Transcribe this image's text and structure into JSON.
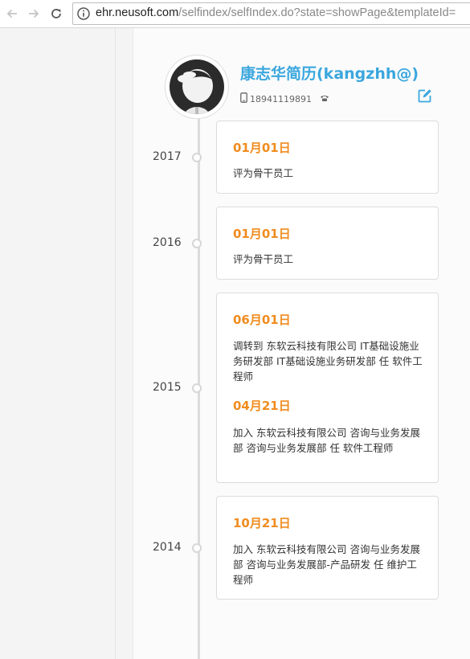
{
  "browser": {
    "url_host": "ehr.neusoft.com",
    "url_path": "/selfindex/selfIndex.do?state=showPage&templateId="
  },
  "profile": {
    "name": "康志华简历(kangzhh@)",
    "phone": "18941119891"
  },
  "timeline": [
    {
      "year": "2017",
      "events": [
        {
          "date": "01月01日",
          "text": "评为骨干员工"
        }
      ]
    },
    {
      "year": "2016",
      "events": [
        {
          "date": "01月01日",
          "text": "评为骨干员工"
        }
      ]
    },
    {
      "year": "2015",
      "events": [
        {
          "date": "06月01日",
          "text": "调转到 东软云科技有限公司 IT基础设施业务研发部 IT基础设施业务研发部 任 软件工程师"
        },
        {
          "date": "04月21日",
          "text": "加入 东软云科技有限公司 咨询与业务发展部 咨询与业务发展部 任 软件工程师"
        }
      ]
    },
    {
      "year": "2014",
      "events": [
        {
          "date": "10月21日",
          "text": "加入 东软云科技有限公司 咨询与业务发展部 咨询与业务发展部-产品研发 任 维护工程师"
        }
      ]
    }
  ],
  "icons": {
    "back": "arrow-left-icon",
    "forward": "arrow-right-icon",
    "reload": "reload-icon",
    "info": "info-icon",
    "mobile": "mobile-phone-icon",
    "telephone": "telephone-icon",
    "edit": "edit-icon"
  },
  "colors": {
    "name": "#3ba7de",
    "date": "#f08c1e",
    "edit_icon": "#3ba7de"
  }
}
